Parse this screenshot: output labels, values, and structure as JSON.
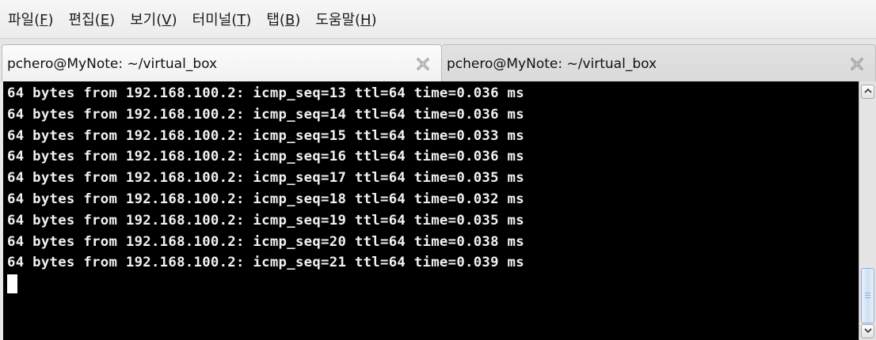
{
  "menubar": {
    "items": [
      {
        "label": "파일(",
        "mnemonic": "F",
        "tail": ")"
      },
      {
        "label": "편집(",
        "mnemonic": "E",
        "tail": ")"
      },
      {
        "label": "보기(",
        "mnemonic": "V",
        "tail": ")"
      },
      {
        "label": "터미널(",
        "mnemonic": "T",
        "tail": ")"
      },
      {
        "label": "탭(",
        "mnemonic": "B",
        "tail": ")"
      },
      {
        "label": "도움말(",
        "mnemonic": "H",
        "tail": ")"
      }
    ]
  },
  "tabs": [
    {
      "title": "pchero@MyNote: ~/virtual_box",
      "active": true,
      "close_icon": "close-icon"
    },
    {
      "title": "pchero@MyNote: ~/virtual_box",
      "active": false,
      "close_icon": "close-icon"
    }
  ],
  "terminal": {
    "lines": [
      "64 bytes from 192.168.100.2: icmp_seq=13 ttl=64 time=0.036 ms",
      "64 bytes from 192.168.100.2: icmp_seq=14 ttl=64 time=0.036 ms",
      "64 bytes from 192.168.100.2: icmp_seq=15 ttl=64 time=0.033 ms",
      "64 bytes from 192.168.100.2: icmp_seq=16 ttl=64 time=0.036 ms",
      "64 bytes from 192.168.100.2: icmp_seq=17 ttl=64 time=0.035 ms",
      "64 bytes from 192.168.100.2: icmp_seq=18 ttl=64 time=0.032 ms",
      "64 bytes from 192.168.100.2: icmp_seq=19 ttl=64 time=0.035 ms",
      "64 bytes from 192.168.100.2: icmp_seq=20 ttl=64 time=0.038 ms",
      "64 bytes from 192.168.100.2: icmp_seq=21 ttl=64 time=0.039 ms"
    ],
    "background": "#000000",
    "foreground": "#f2f2f2"
  },
  "scrollbar": {
    "thumb_color": "#cfe0f3"
  }
}
